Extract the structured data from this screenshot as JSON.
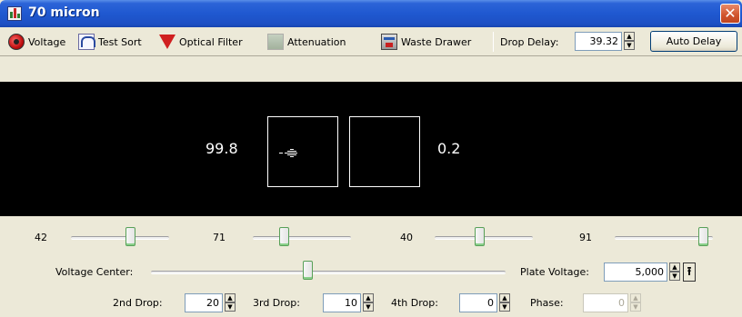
{
  "window": {
    "title": "70 micron",
    "close_glyph": "✕"
  },
  "toolbar": {
    "voltage_label": "Voltage",
    "test_sort_label": "Test Sort",
    "optical_filter_label": "Optical Filter",
    "attenuation_label": "Attenuation",
    "waste_drawer_label": "Waste Drawer",
    "drop_delay_label": "Drop Delay:",
    "drop_delay_value": "39.32",
    "auto_delay_label": "Auto Delay",
    "icons": [
      "voltage-icon",
      "test-sort-icon",
      "optical-filter-icon",
      "attenuation-icon",
      "waste-drawer-icon"
    ]
  },
  "display": {
    "left_percent": "99.8",
    "right_percent": "0.2",
    "background": "#000000"
  },
  "sliders": [
    {
      "value": "42",
      "level": 0.62
    },
    {
      "value": "71",
      "level": 0.3
    },
    {
      "value": "40",
      "level": 0.45
    },
    {
      "value": "91",
      "level": 0.95
    }
  ],
  "controls": {
    "voltage_center_label": "Voltage Center:",
    "voltage_center_level": 0.44,
    "plate_voltage_label": "Plate Voltage:",
    "plate_voltage_value": "5,000",
    "second_drop_label": "2nd Drop:",
    "second_drop_value": "20",
    "third_drop_label": "3rd Drop:",
    "third_drop_value": "10",
    "fourth_drop_label": "4th Drop:",
    "fourth_drop_value": "0",
    "phase_label": "Phase:",
    "phase_value": "0"
  },
  "colors": {
    "title_bar": "#1f58d0",
    "close_button": "#d0542c",
    "panel_bg": "#ece9d8",
    "slider_accent": "#58a058"
  }
}
